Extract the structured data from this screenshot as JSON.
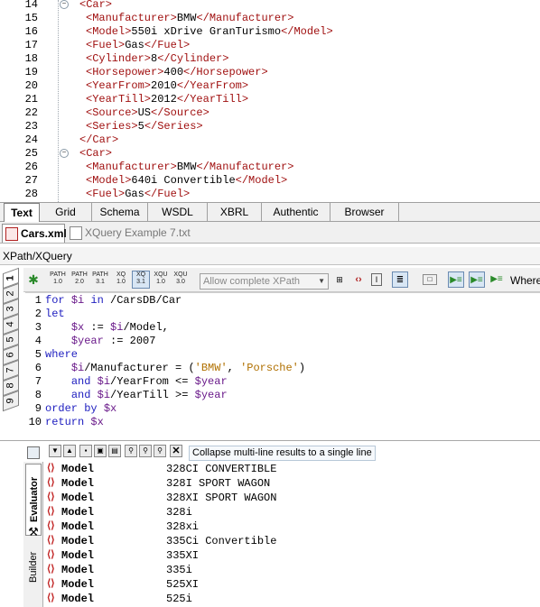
{
  "xml_editor": {
    "lines": [
      {
        "num": "14",
        "fold": "−",
        "parts": [
          [
            "tag",
            "<Car>"
          ]
        ]
      },
      {
        "num": "15",
        "parts": [
          [
            "tag",
            "<Manufacturer>"
          ],
          [
            "txt",
            "BMW"
          ],
          [
            "tag",
            "</Manufacturer>"
          ]
        ]
      },
      {
        "num": "16",
        "parts": [
          [
            "tag",
            "<Model>"
          ],
          [
            "txt",
            "550i xDrive GranTurismo"
          ],
          [
            "tag",
            "</Model>"
          ]
        ]
      },
      {
        "num": "17",
        "parts": [
          [
            "tag",
            "<Fuel>"
          ],
          [
            "txt",
            "Gas"
          ],
          [
            "tag",
            "</Fuel>"
          ]
        ]
      },
      {
        "num": "18",
        "parts": [
          [
            "tag",
            "<Cylinder>"
          ],
          [
            "txt",
            "8"
          ],
          [
            "tag",
            "</Cylinder>"
          ]
        ]
      },
      {
        "num": "19",
        "parts": [
          [
            "tag",
            "<Horsepower>"
          ],
          [
            "txt",
            "400"
          ],
          [
            "tag",
            "</Horsepower>"
          ]
        ]
      },
      {
        "num": "20",
        "parts": [
          [
            "tag",
            "<YearFrom>"
          ],
          [
            "txt",
            "2010"
          ],
          [
            "tag",
            "</YearFrom>"
          ]
        ]
      },
      {
        "num": "21",
        "parts": [
          [
            "tag",
            "<YearTill>"
          ],
          [
            "txt",
            "2012"
          ],
          [
            "tag",
            "</YearTill>"
          ]
        ]
      },
      {
        "num": "22",
        "parts": [
          [
            "tag",
            "<Source>"
          ],
          [
            "txt",
            "US"
          ],
          [
            "tag",
            "</Source>"
          ]
        ]
      },
      {
        "num": "23",
        "parts": [
          [
            "tag",
            "<Series>"
          ],
          [
            "txt",
            "5"
          ],
          [
            "tag",
            "</Series>"
          ]
        ]
      },
      {
        "num": "24",
        "parts": [
          [
            "tag",
            "</Car>"
          ]
        ]
      },
      {
        "num": "25",
        "fold": "−",
        "parts": [
          [
            "tag",
            "<Car>"
          ]
        ]
      },
      {
        "num": "26",
        "parts": [
          [
            "tag",
            "<Manufacturer>"
          ],
          [
            "txt",
            "BMW"
          ],
          [
            "tag",
            "</Manufacturer>"
          ]
        ]
      },
      {
        "num": "27",
        "parts": [
          [
            "tag",
            "<Model>"
          ],
          [
            "txt",
            "640i Convertible"
          ],
          [
            "tag",
            "</Model>"
          ]
        ]
      },
      {
        "num": "28",
        "parts": [
          [
            "tag",
            "<Fuel>"
          ],
          [
            "txt",
            "Gas"
          ],
          [
            "tag",
            "</Fuel>"
          ]
        ]
      }
    ]
  },
  "view_tabs": {
    "text": "Text",
    "grid": "Grid",
    "schema": "Schema",
    "wsdl": "WSDL",
    "xbrl": "XBRL",
    "authentic": "Authentic",
    "browser": "Browser"
  },
  "file_tabs": {
    "cars": "Cars.xml",
    "xquery": "XQuery Example 7.txt"
  },
  "xpath_panel": {
    "title": "XPath/XQuery",
    "side_tabs": [
      "1",
      "2",
      "3",
      "4",
      "5",
      "6",
      "7",
      "8",
      "9"
    ],
    "toolbar": {
      "path10": [
        "PATH",
        "1.0"
      ],
      "path20": [
        "PATH",
        "2.0"
      ],
      "path31": [
        "PATH",
        "3.1"
      ],
      "xq10": [
        "XQ",
        "1.0"
      ],
      "xq31": [
        "XQ",
        "3.1"
      ],
      "xqu10": [
        "XQU",
        "1.0"
      ],
      "xqu30": [
        "XQU",
        "3.0"
      ],
      "xpath_placeholder": "Allow complete XPath",
      "where": "Where"
    },
    "query_lines": [
      {
        "num": "1",
        "parts": [
          [
            "kw",
            "for "
          ],
          [
            "var",
            "$i"
          ],
          [
            "kw",
            " in "
          ],
          [
            "plain",
            "/CarsDB/Car"
          ]
        ]
      },
      {
        "num": "2",
        "parts": [
          [
            "kw",
            "let"
          ]
        ]
      },
      {
        "num": "3",
        "parts": [
          [
            "plain",
            "    "
          ],
          [
            "var",
            "$x"
          ],
          [
            "plain",
            " := "
          ],
          [
            "var",
            "$i"
          ],
          [
            "plain",
            "/Model,"
          ]
        ]
      },
      {
        "num": "4",
        "parts": [
          [
            "plain",
            "    "
          ],
          [
            "var",
            "$year"
          ],
          [
            "plain",
            " := 2007"
          ]
        ]
      },
      {
        "num": "5",
        "parts": [
          [
            "kw",
            "where"
          ]
        ]
      },
      {
        "num": "6",
        "parts": [
          [
            "plain",
            "    "
          ],
          [
            "var",
            "$i"
          ],
          [
            "plain",
            "/Manufacturer = ("
          ],
          [
            "str",
            "'BMW'"
          ],
          [
            "plain",
            ", "
          ],
          [
            "str",
            "'Porsche'"
          ],
          [
            "plain",
            ")"
          ]
        ]
      },
      {
        "num": "7",
        "parts": [
          [
            "plain",
            "    "
          ],
          [
            "kw",
            "and "
          ],
          [
            "var",
            "$i"
          ],
          [
            "plain",
            "/YearFrom <= "
          ],
          [
            "var",
            "$year"
          ]
        ]
      },
      {
        "num": "8",
        "parts": [
          [
            "plain",
            "    "
          ],
          [
            "kw",
            "and "
          ],
          [
            "var",
            "$i"
          ],
          [
            "plain",
            "/YearTill >= "
          ],
          [
            "var",
            "$year"
          ]
        ]
      },
      {
        "num": "9",
        "parts": [
          [
            "kw",
            "order by "
          ],
          [
            "var",
            "$x"
          ]
        ]
      },
      {
        "num": "10",
        "parts": [
          [
            "kw",
            "return "
          ],
          [
            "var",
            "$x"
          ]
        ]
      }
    ]
  },
  "results": {
    "collapse_label": "Collapse multi-line results to a single line",
    "evaluator": "Evaluator",
    "builder": "Builder",
    "rows": [
      {
        "name": "Model",
        "value": "328CI CONVERTIBLE"
      },
      {
        "name": "Model",
        "value": "328I SPORT WAGON"
      },
      {
        "name": "Model",
        "value": "328XI SPORT WAGON"
      },
      {
        "name": "Model",
        "value": "328i"
      },
      {
        "name": "Model",
        "value": "328xi"
      },
      {
        "name": "Model",
        "value": "335Ci Convertible"
      },
      {
        "name": "Model",
        "value": "335XI"
      },
      {
        "name": "Model",
        "value": "335i"
      },
      {
        "name": "Model",
        "value": "525XI"
      },
      {
        "name": "Model",
        "value": "525i"
      }
    ]
  }
}
